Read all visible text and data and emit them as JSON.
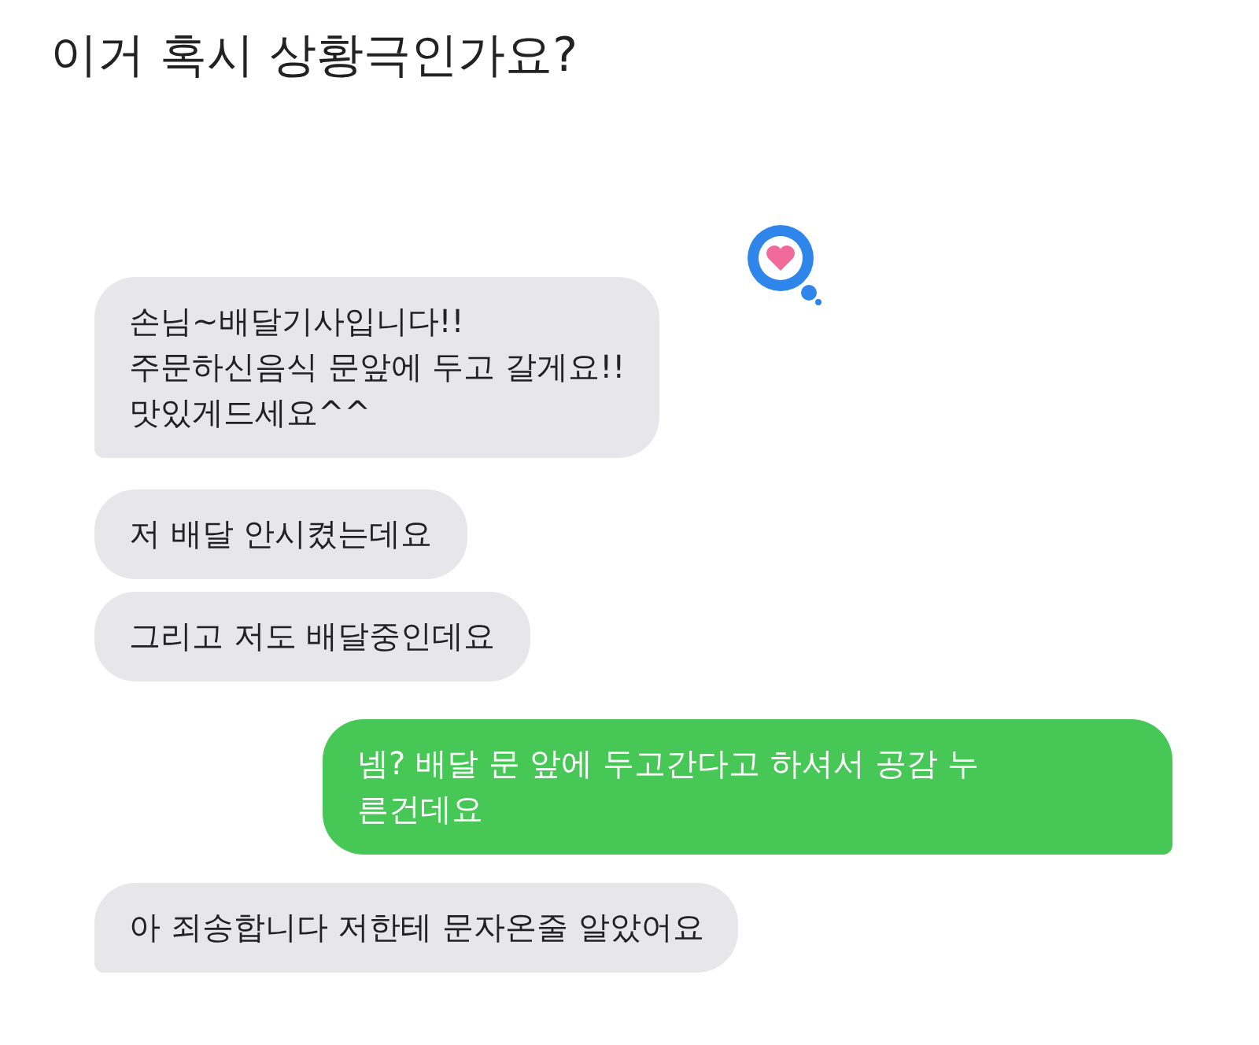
{
  "title": "이거 혹시 상황극인가요?",
  "messages": [
    {
      "kind": "received",
      "text": "손님~배달기사입니다!!\n주문하신음식 문앞에 두고 갈게요!!\n맛있게드세요^^",
      "reacted": true,
      "tail": true
    },
    {
      "kind": "received",
      "text": "저 배달 안시켰는데요",
      "reacted": false,
      "tail": false
    },
    {
      "kind": "received",
      "text": "그리고 저도 배달중인데요",
      "reacted": false,
      "tail": false
    },
    {
      "kind": "sent",
      "text": "넴? 배달 문 앞에 두고간다고 하셔서 공감 누\n른건데요",
      "reacted": false,
      "tail": true
    },
    {
      "kind": "received",
      "text": "아 죄송합니다 저한테 문자온줄 알았어요",
      "reacted": false,
      "tail": true
    }
  ]
}
